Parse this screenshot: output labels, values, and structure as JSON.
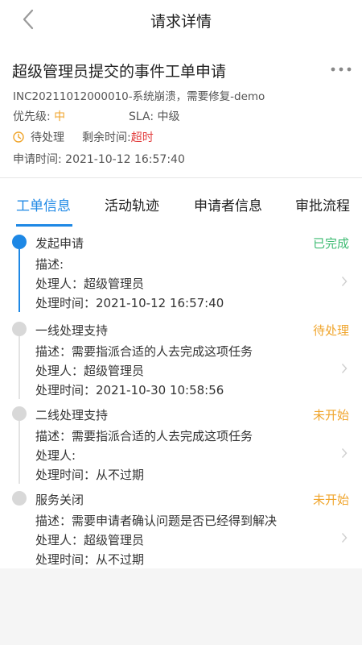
{
  "nav": {
    "title": "请求详情"
  },
  "ticket": {
    "title": "超级管理员提交的事件工单申请",
    "subtitle": "INC20211012000010-系统崩溃，需要修复-demo",
    "priority_label": "优先级:",
    "priority_value": "中",
    "sla_label": "SLA:",
    "sla_value": "中级",
    "status": "待处理",
    "remaining_label": "剩余时间:",
    "remaining_value": "超时",
    "apply_time_label": "申请时间:",
    "apply_time": "2021-10-12 16:57:40"
  },
  "tabs": [
    {
      "label": "工单信息"
    },
    {
      "label": "活动轨迹"
    },
    {
      "label": "申请者信息"
    },
    {
      "label": "审批流程"
    }
  ],
  "steps": [
    {
      "name": "发起申请",
      "status": "已完成",
      "desc": "描述:",
      "handler": "处理人：超级管理员",
      "time": "处理时间：2021-10-12 16:57:40"
    },
    {
      "name": "一线处理支持",
      "status": "待处理",
      "desc": "描述：需要指派合适的人去完成这项任务",
      "handler": "处理人：超级管理员",
      "time": "处理时间：2021-10-30 10:58:56"
    },
    {
      "name": "二线处理支持",
      "status": "未开始",
      "desc": "描述：需要指派合适的人去完成这项任务",
      "handler": "处理人:",
      "time": "处理时间：从不过期"
    },
    {
      "name": "服务关闭",
      "status": "未开始",
      "desc": "描述：需要申请者确认问题是否已经得到解决",
      "handler": "处理人：超级管理员",
      "time": "处理时间：从不过期"
    }
  ],
  "colors": {
    "accent": "#1e88e5",
    "done": "#3dbb72",
    "pending": "#f0a52c",
    "overdue": "#e23c3c"
  }
}
